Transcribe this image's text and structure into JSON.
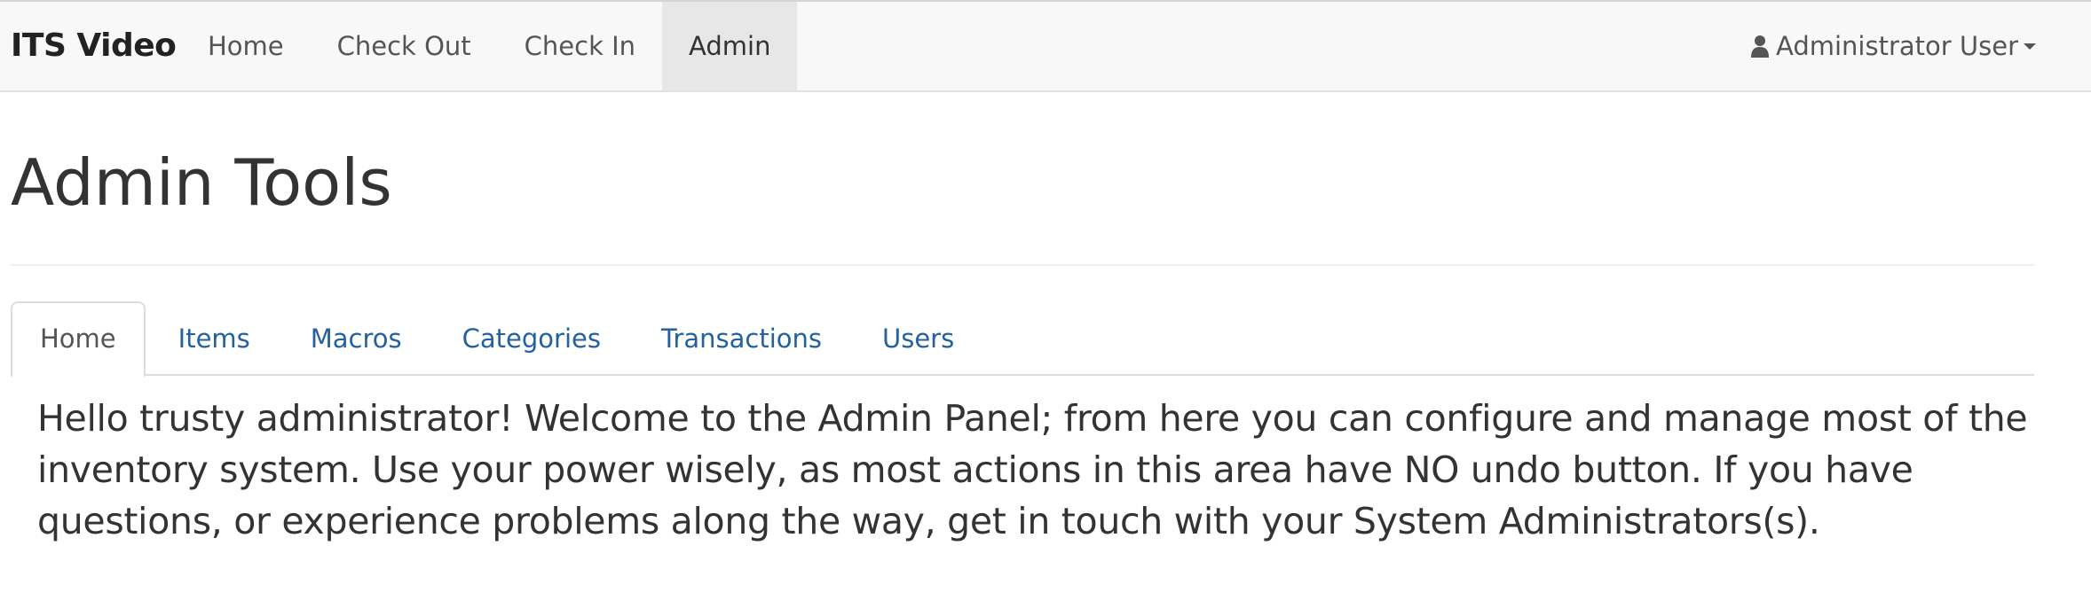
{
  "navbar": {
    "brand": "ITS Video",
    "links": [
      {
        "label": "Home",
        "active": false
      },
      {
        "label": "Check Out",
        "active": false
      },
      {
        "label": "Check In",
        "active": false
      },
      {
        "label": "Admin",
        "active": true
      }
    ],
    "user": {
      "icon": "user-icon",
      "label": "Administrator User"
    }
  },
  "page": {
    "title": "Admin Tools"
  },
  "tabs": [
    {
      "label": "Home",
      "active": true
    },
    {
      "label": "Items",
      "active": false
    },
    {
      "label": "Macros",
      "active": false
    },
    {
      "label": "Categories",
      "active": false
    },
    {
      "label": "Transactions",
      "active": false
    },
    {
      "label": "Users",
      "active": false
    }
  ],
  "content": {
    "welcome_text": "Hello trusty administrator! Welcome to the Admin Panel; from here you can configure and manage most of the inventory system. Use your power wisely, as most actions in this area have NO undo button. If you have questions, or experience problems along the way, get in touch with your System Administrators(s)."
  },
  "colors": {
    "navbar_bg": "#f8f8f8",
    "active_nav_bg": "#e7e7e7",
    "link_blue": "#23629f",
    "text": "#333333"
  }
}
